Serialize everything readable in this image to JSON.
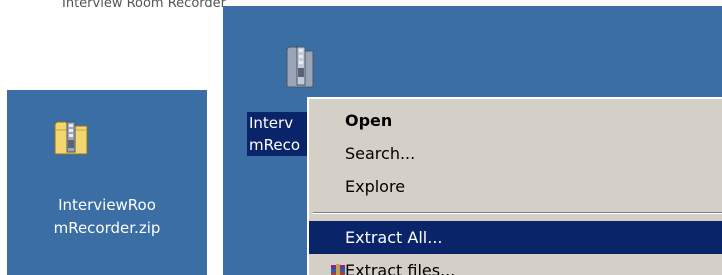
{
  "window": {
    "title_fragment": "Interview Room Recorder"
  },
  "left_panel": {
    "icon": "zip-folder-icon",
    "label": "InterviewRoo\nmRecorder.zip"
  },
  "right_panel": {
    "icon": "zip-folder-icon",
    "label_visible": "Interv\nmReco"
  },
  "context_menu": {
    "items": [
      {
        "label": "Open",
        "default": true
      },
      {
        "label": "Search..."
      },
      {
        "label": "Explore"
      },
      {
        "label": "Extract All...",
        "highlighted": true
      },
      {
        "label": "Extract files...",
        "icon": "winrar-books-icon"
      }
    ]
  },
  "colors": {
    "desktop": "#3a6ea5",
    "selection": "#0a246a",
    "menu": "#d4d0c8"
  }
}
